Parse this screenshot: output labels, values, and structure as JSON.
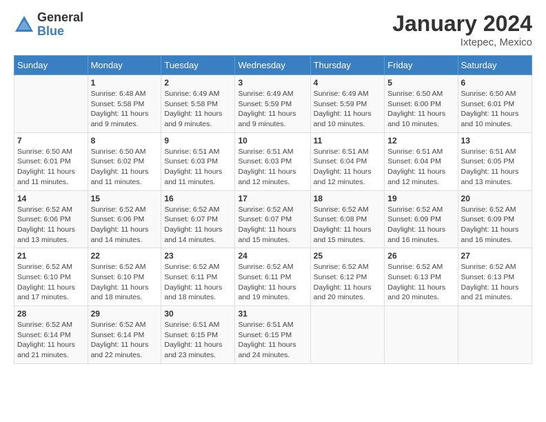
{
  "header": {
    "logo_general": "General",
    "logo_blue": "Blue",
    "month_title": "January 2024",
    "location": "Ixtepec, Mexico"
  },
  "days_of_week": [
    "Sunday",
    "Monday",
    "Tuesday",
    "Wednesday",
    "Thursday",
    "Friday",
    "Saturday"
  ],
  "weeks": [
    [
      {
        "day": "",
        "info": ""
      },
      {
        "day": "1",
        "info": "Sunrise: 6:48 AM\nSunset: 5:58 PM\nDaylight: 11 hours\nand 9 minutes."
      },
      {
        "day": "2",
        "info": "Sunrise: 6:49 AM\nSunset: 5:58 PM\nDaylight: 11 hours\nand 9 minutes."
      },
      {
        "day": "3",
        "info": "Sunrise: 6:49 AM\nSunset: 5:59 PM\nDaylight: 11 hours\nand 9 minutes."
      },
      {
        "day": "4",
        "info": "Sunrise: 6:49 AM\nSunset: 5:59 PM\nDaylight: 11 hours\nand 10 minutes."
      },
      {
        "day": "5",
        "info": "Sunrise: 6:50 AM\nSunset: 6:00 PM\nDaylight: 11 hours\nand 10 minutes."
      },
      {
        "day": "6",
        "info": "Sunrise: 6:50 AM\nSunset: 6:01 PM\nDaylight: 11 hours\nand 10 minutes."
      }
    ],
    [
      {
        "day": "7",
        "info": "Sunrise: 6:50 AM\nSunset: 6:01 PM\nDaylight: 11 hours\nand 11 minutes."
      },
      {
        "day": "8",
        "info": "Sunrise: 6:50 AM\nSunset: 6:02 PM\nDaylight: 11 hours\nand 11 minutes."
      },
      {
        "day": "9",
        "info": "Sunrise: 6:51 AM\nSunset: 6:03 PM\nDaylight: 11 hours\nand 11 minutes."
      },
      {
        "day": "10",
        "info": "Sunrise: 6:51 AM\nSunset: 6:03 PM\nDaylight: 11 hours\nand 12 minutes."
      },
      {
        "day": "11",
        "info": "Sunrise: 6:51 AM\nSunset: 6:04 PM\nDaylight: 11 hours\nand 12 minutes."
      },
      {
        "day": "12",
        "info": "Sunrise: 6:51 AM\nSunset: 6:04 PM\nDaylight: 11 hours\nand 12 minutes."
      },
      {
        "day": "13",
        "info": "Sunrise: 6:51 AM\nSunset: 6:05 PM\nDaylight: 11 hours\nand 13 minutes."
      }
    ],
    [
      {
        "day": "14",
        "info": "Sunrise: 6:52 AM\nSunset: 6:06 PM\nDaylight: 11 hours\nand 13 minutes."
      },
      {
        "day": "15",
        "info": "Sunrise: 6:52 AM\nSunset: 6:06 PM\nDaylight: 11 hours\nand 14 minutes."
      },
      {
        "day": "16",
        "info": "Sunrise: 6:52 AM\nSunset: 6:07 PM\nDaylight: 11 hours\nand 14 minutes."
      },
      {
        "day": "17",
        "info": "Sunrise: 6:52 AM\nSunset: 6:07 PM\nDaylight: 11 hours\nand 15 minutes."
      },
      {
        "day": "18",
        "info": "Sunrise: 6:52 AM\nSunset: 6:08 PM\nDaylight: 11 hours\nand 15 minutes."
      },
      {
        "day": "19",
        "info": "Sunrise: 6:52 AM\nSunset: 6:09 PM\nDaylight: 11 hours\nand 16 minutes."
      },
      {
        "day": "20",
        "info": "Sunrise: 6:52 AM\nSunset: 6:09 PM\nDaylight: 11 hours\nand 16 minutes."
      }
    ],
    [
      {
        "day": "21",
        "info": "Sunrise: 6:52 AM\nSunset: 6:10 PM\nDaylight: 11 hours\nand 17 minutes."
      },
      {
        "day": "22",
        "info": "Sunrise: 6:52 AM\nSunset: 6:10 PM\nDaylight: 11 hours\nand 18 minutes."
      },
      {
        "day": "23",
        "info": "Sunrise: 6:52 AM\nSunset: 6:11 PM\nDaylight: 11 hours\nand 18 minutes."
      },
      {
        "day": "24",
        "info": "Sunrise: 6:52 AM\nSunset: 6:11 PM\nDaylight: 11 hours\nand 19 minutes."
      },
      {
        "day": "25",
        "info": "Sunrise: 6:52 AM\nSunset: 6:12 PM\nDaylight: 11 hours\nand 20 minutes."
      },
      {
        "day": "26",
        "info": "Sunrise: 6:52 AM\nSunset: 6:13 PM\nDaylight: 11 hours\nand 20 minutes."
      },
      {
        "day": "27",
        "info": "Sunrise: 6:52 AM\nSunset: 6:13 PM\nDaylight: 11 hours\nand 21 minutes."
      }
    ],
    [
      {
        "day": "28",
        "info": "Sunrise: 6:52 AM\nSunset: 6:14 PM\nDaylight: 11 hours\nand 21 minutes."
      },
      {
        "day": "29",
        "info": "Sunrise: 6:52 AM\nSunset: 6:14 PM\nDaylight: 11 hours\nand 22 minutes."
      },
      {
        "day": "30",
        "info": "Sunrise: 6:51 AM\nSunset: 6:15 PM\nDaylight: 11 hours\nand 23 minutes."
      },
      {
        "day": "31",
        "info": "Sunrise: 6:51 AM\nSunset: 6:15 PM\nDaylight: 11 hours\nand 24 minutes."
      },
      {
        "day": "",
        "info": ""
      },
      {
        "day": "",
        "info": ""
      },
      {
        "day": "",
        "info": ""
      }
    ]
  ]
}
